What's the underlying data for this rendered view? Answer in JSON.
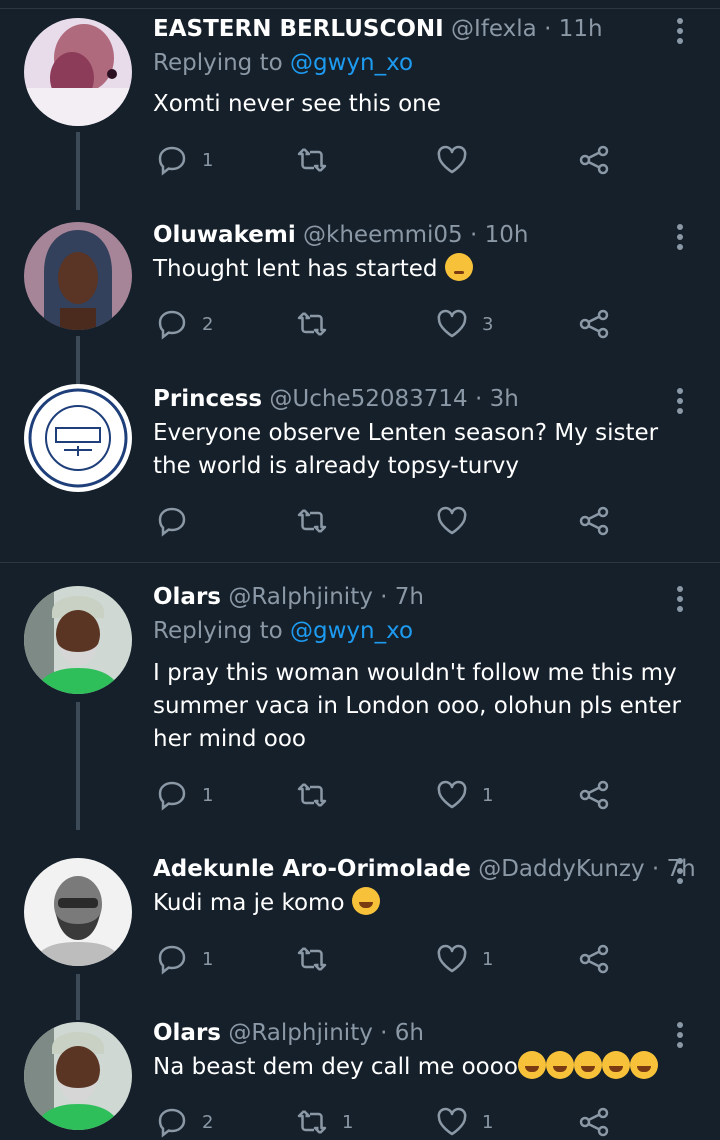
{
  "colors": {
    "background": "#15202b",
    "name": "#ffffff",
    "muted": "#8b98a5",
    "link": "#1d9bf0",
    "divider": "#2a3642",
    "thread_line": "#3d4a57"
  },
  "tweets": [
    {
      "name": "EASTERN BERLUSCONI",
      "handle": "@Ifexla",
      "dot": "·",
      "time": "11h",
      "replying_prefix": "Replying to ",
      "replying_to": "@gwyn_xo",
      "text": "Xomti never see this one",
      "reply_count": "1",
      "retweet_count": "",
      "like_count": ""
    },
    {
      "name": "Oluwakemi",
      "handle": "@kheemmi05",
      "dot": "·",
      "time": "10h",
      "text": "Thought lent has started",
      "emoji": "thinking-face",
      "reply_count": "2",
      "retweet_count": "",
      "like_count": "3"
    },
    {
      "name": "Princess",
      "handle": "@Uche52083714",
      "dot": "·",
      "time": "3h",
      "text": "Everyone observe Lenten season? My sister the world is already topsy-turvy",
      "reply_count": "",
      "retweet_count": "",
      "like_count": ""
    },
    {
      "name": "Olars",
      "handle": "@Ralphjinity",
      "dot": "·",
      "time": "7h",
      "replying_prefix": "Replying to ",
      "replying_to": "@gwyn_xo",
      "text": "I pray this woman wouldn't follow me this my summer vaca in London ooo, olohun pls enter her mind ooo",
      "reply_count": "1",
      "retweet_count": "",
      "like_count": "1"
    },
    {
      "name": "Adekunle Aro-Orimolade",
      "handle": "@DaddyKunzy",
      "dot": "·",
      "time": "7h",
      "text": "Kudi ma je komo",
      "emoji": "tears-of-joy",
      "reply_count": "1",
      "retweet_count": "",
      "like_count": "1"
    },
    {
      "name": "Olars",
      "handle": "@Ralphjinity",
      "dot": "·",
      "time": "6h",
      "text": "Na beast dem dey call me oooo",
      "emoji": "rolling-laughing-and-zany-faces",
      "reply_count": "2",
      "retweet_count": "1",
      "like_count": "1"
    }
  ]
}
